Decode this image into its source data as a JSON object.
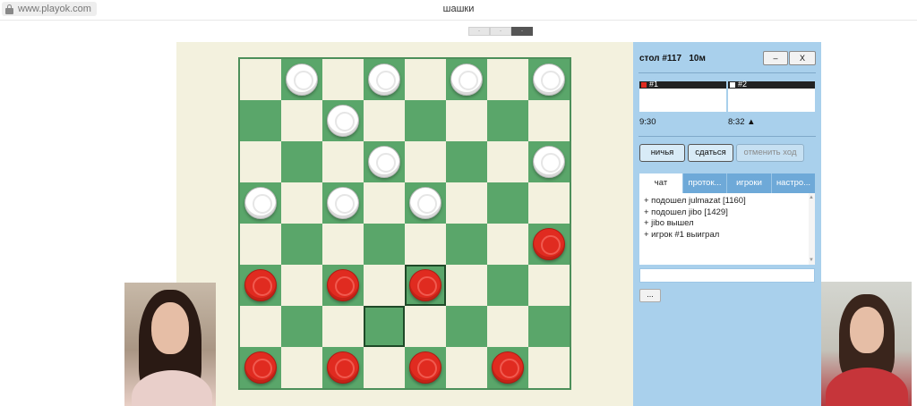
{
  "browser": {
    "url": "www.playok.com",
    "lock_icon": "lock-icon"
  },
  "page": {
    "title": "шашки"
  },
  "mini_nav": [
    "-",
    "-",
    "-"
  ],
  "board": {
    "size": 8,
    "colors": {
      "light": "#f3f1de",
      "dark": "#5aa66a",
      "white_piece": "#ffffff",
      "red_piece": "#e02b20"
    },
    "highlighted": [
      [
        5,
        4
      ],
      [
        6,
        3
      ]
    ],
    "pieces": [
      {
        "row": 0,
        "col": 1,
        "color": "white"
      },
      {
        "row": 0,
        "col": 3,
        "color": "white"
      },
      {
        "row": 0,
        "col": 5,
        "color": "white"
      },
      {
        "row": 0,
        "col": 7,
        "color": "white"
      },
      {
        "row": 1,
        "col": 2,
        "color": "white"
      },
      {
        "row": 2,
        "col": 3,
        "color": "white"
      },
      {
        "row": 2,
        "col": 7,
        "color": "white"
      },
      {
        "row": 3,
        "col": 0,
        "color": "white"
      },
      {
        "row": 3,
        "col": 2,
        "color": "white"
      },
      {
        "row": 3,
        "col": 4,
        "color": "white"
      },
      {
        "row": 4,
        "col": 7,
        "color": "red"
      },
      {
        "row": 5,
        "col": 0,
        "color": "red"
      },
      {
        "row": 5,
        "col": 2,
        "color": "red"
      },
      {
        "row": 5,
        "col": 4,
        "color": "red"
      },
      {
        "row": 7,
        "col": 0,
        "color": "red"
      },
      {
        "row": 7,
        "col": 2,
        "color": "red"
      },
      {
        "row": 7,
        "col": 4,
        "color": "red"
      },
      {
        "row": 7,
        "col": 6,
        "color": "red"
      }
    ]
  },
  "panel": {
    "table_title": "стол #117",
    "time_control": "10м",
    "minimize_label": "–",
    "close_label": "X",
    "player1": {
      "label": "#1",
      "clock": "9:30"
    },
    "player2": {
      "label": "#2",
      "clock": "8:32 ▲"
    },
    "actions": {
      "draw": "ничья",
      "resign": "сдаться",
      "undo": "отменить ход"
    },
    "tabs": [
      "чат",
      "проток...",
      "игроки",
      "настро..."
    ],
    "chat": [
      "+ подошел julmazat [1160]",
      "+ подошел jibo [1429]",
      "+ jibo вышел",
      "+ игрок #1 выиграл"
    ],
    "more_label": "..."
  },
  "webcams": [
    "left-webcam",
    "right-webcam"
  ]
}
